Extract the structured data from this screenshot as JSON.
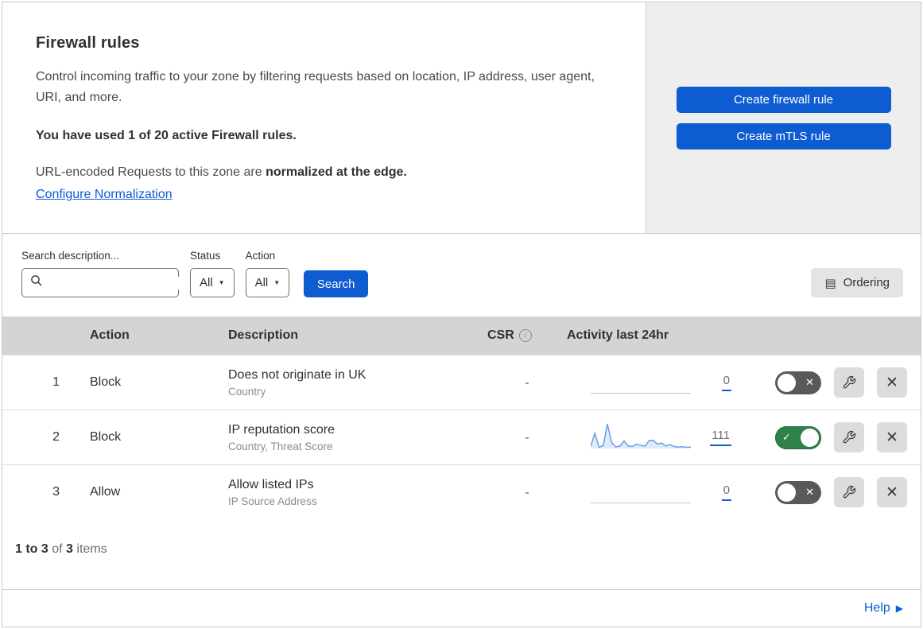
{
  "page": {
    "title": "Firewall rules",
    "description": "Control incoming traffic to your zone by filtering requests based on location, IP address, user agent, URI, and more.",
    "usage_text": "You have used 1 of 20 active Firewall rules.",
    "normalization_prefix": "URL-encoded Requests to this zone are ",
    "normalization_bold": "normalized at the edge.",
    "normalization_link": "Configure Normalization"
  },
  "actions_panel": {
    "create_firewall_rule": "Create firewall rule",
    "create_mtls_rule": "Create mTLS rule"
  },
  "filters": {
    "search_label": "Search description...",
    "search_placeholder": "",
    "search_value": "",
    "status_label": "Status",
    "status_value": "All",
    "action_label": "Action",
    "action_value": "All",
    "search_button": "Search",
    "ordering_button": "Ordering"
  },
  "table": {
    "headers": {
      "action": "Action",
      "description": "Description",
      "csr": "CSR",
      "csr_info": "i",
      "activity": "Activity last 24hr"
    },
    "rows": [
      {
        "number": "1",
        "action": "Block",
        "title": "Does not originate in UK",
        "subtitle": "Country",
        "csr": "-",
        "count": "0",
        "enabled": false
      },
      {
        "number": "2",
        "action": "Block",
        "title": "IP reputation score",
        "subtitle": "Country, Threat Score",
        "csr": "-",
        "count": "111",
        "enabled": true,
        "sparkline": [
          10,
          62,
          5,
          12,
          100,
          25,
          6,
          10,
          30,
          10,
          8,
          18,
          12,
          10,
          32,
          33,
          18,
          22,
          10,
          16,
          8,
          6,
          7,
          5,
          6
        ]
      },
      {
        "number": "3",
        "action": "Allow",
        "title": "Allow listed IPs",
        "subtitle": "IP Source Address",
        "csr": "-",
        "count": "0",
        "enabled": false
      }
    ]
  },
  "chart_data": {
    "type": "area",
    "title": "Activity last 24hr (rule 2 sparkline)",
    "x": [
      1,
      2,
      3,
      4,
      5,
      6,
      7,
      8,
      9,
      10,
      11,
      12,
      13,
      14,
      15,
      16,
      17,
      18,
      19,
      20,
      21,
      22,
      23,
      24,
      25
    ],
    "values": [
      10,
      62,
      5,
      12,
      100,
      25,
      6,
      10,
      30,
      10,
      8,
      18,
      12,
      10,
      32,
      33,
      18,
      22,
      10,
      16,
      8,
      6,
      7,
      5,
      6
    ],
    "ylim": [
      0,
      100
    ],
    "total_label": "111"
  },
  "footer": {
    "range": "1 to 3",
    "of": " of ",
    "total": "3",
    "items": " items"
  },
  "help": {
    "label": "Help"
  },
  "colors": {
    "accent_blue": "#0d5cd1",
    "toggle_on_green": "#2e8148",
    "toggle_off_gray": "#595959",
    "sparkline_blue": "#6d9ee8",
    "table_header_gray": "#d4d4d4",
    "panel_gray": "#eeeeee"
  }
}
